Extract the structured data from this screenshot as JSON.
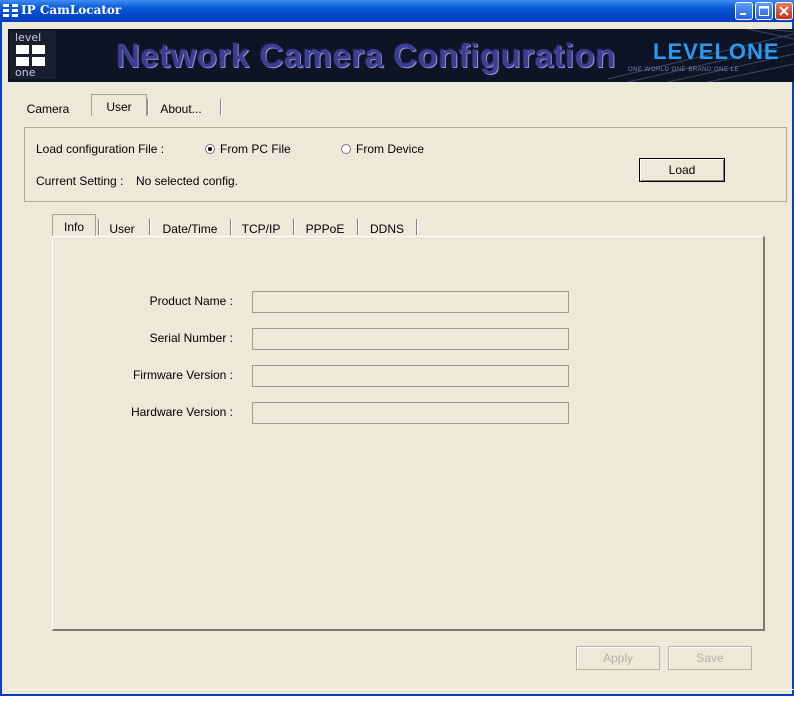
{
  "window": {
    "title": "IP CamLocator",
    "titlebar_color": "#0a5bd6"
  },
  "banner": {
    "heading": "Network Camera Configuration",
    "logo_top": "level",
    "logo_bottom": "one",
    "brand": "LEVELONE",
    "brand_sub": "ONE WORLD ONE BRAND ONE LE"
  },
  "top_tabs": [
    {
      "label": "Camera"
    },
    {
      "label": "User"
    },
    {
      "label": "About..."
    }
  ],
  "load_config": {
    "label": "Load configuration File :",
    "option_pc": "From PC File",
    "option_device": "From Device",
    "selected": "From PC File",
    "current_setting_label": "Current Setting :",
    "current_setting_value": "No selected config.",
    "load_button": "Load"
  },
  "inner_tabs": [
    {
      "label": "Info"
    },
    {
      "label": "User"
    },
    {
      "label": "Date/Time"
    },
    {
      "label": "TCP/IP"
    },
    {
      "label": "PPPoE"
    },
    {
      "label": "DDNS"
    }
  ],
  "info": {
    "product_name_label": "Product Name :",
    "product_name_value": "",
    "serial_number_label": "Serial Number :",
    "serial_number_value": "",
    "firmware_version_label": "Firmware Version :",
    "firmware_version_value": "",
    "hardware_version_label": "Hardware Version :",
    "hardware_version_value": ""
  },
  "actions": {
    "apply": "Apply",
    "save": "Save"
  }
}
